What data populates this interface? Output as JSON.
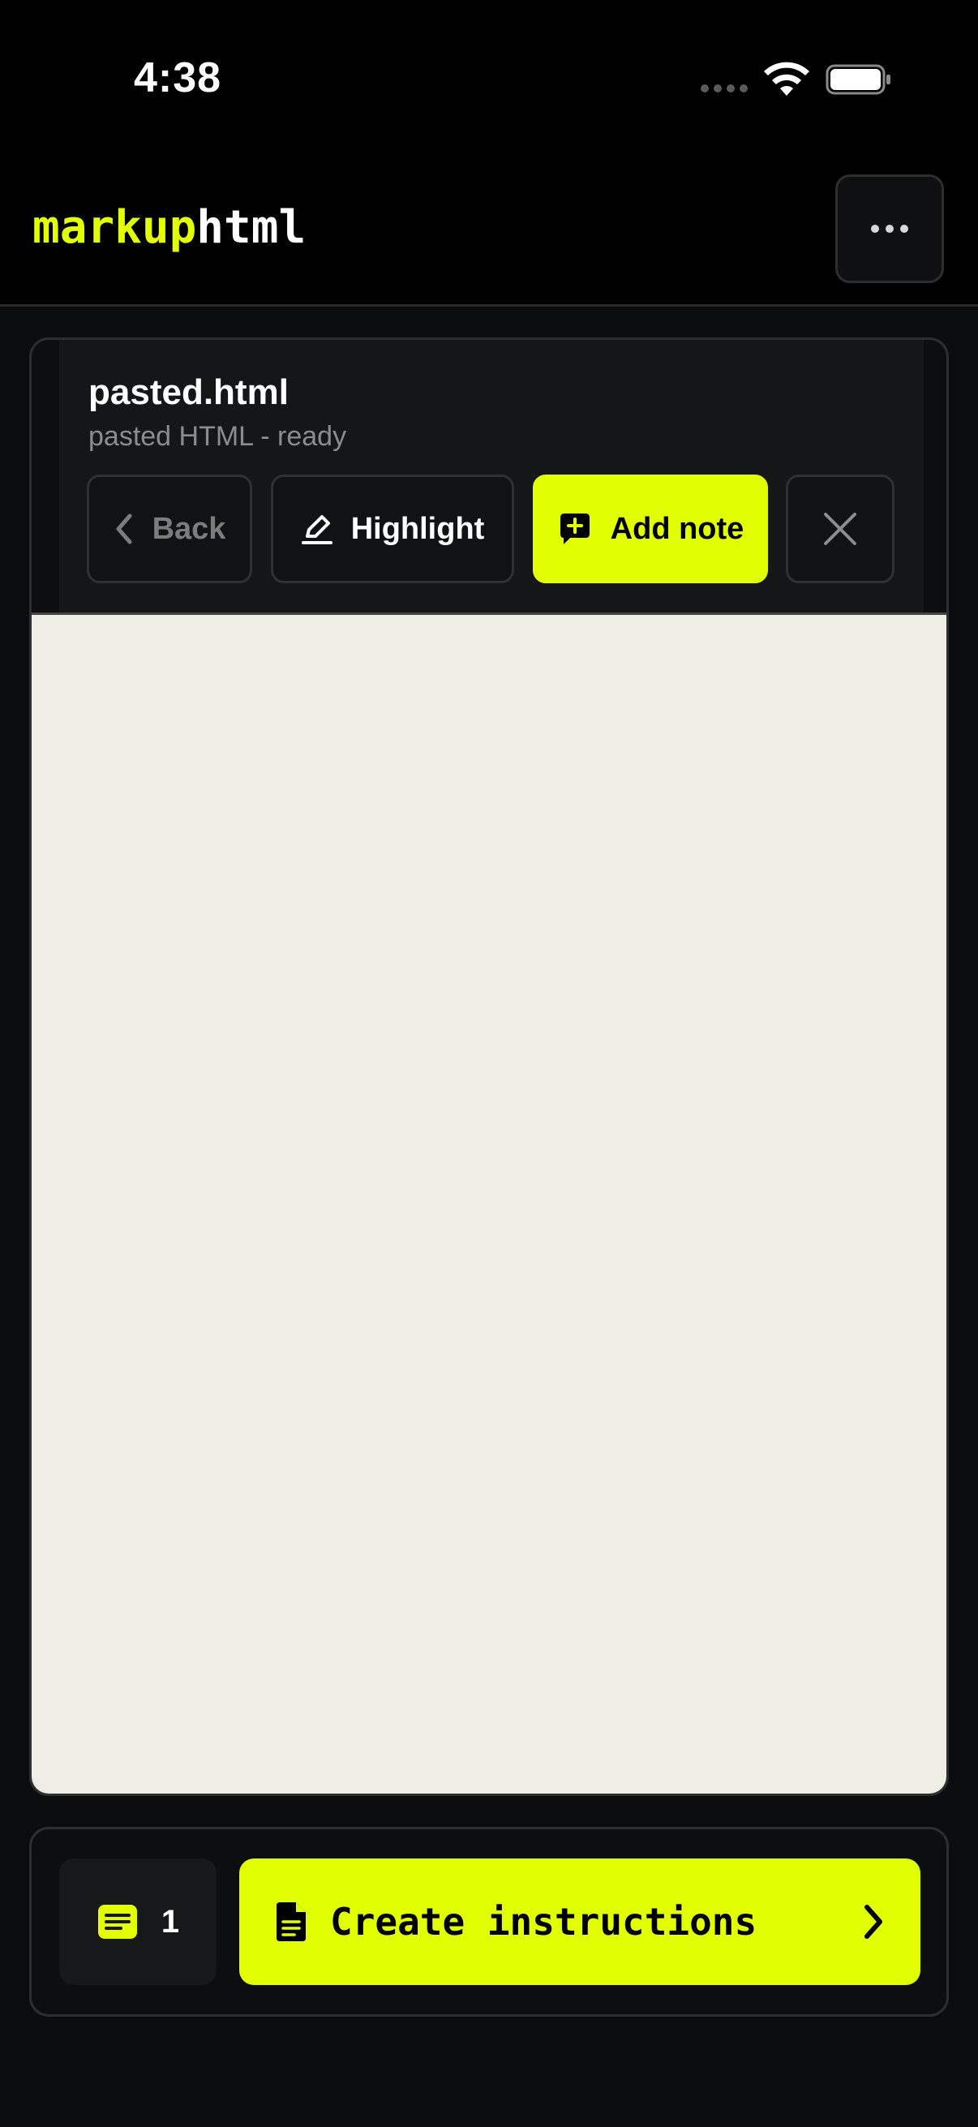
{
  "status_bar": {
    "time": "4:38"
  },
  "header": {
    "logo_part_a": "markup",
    "logo_part_b": "html"
  },
  "document": {
    "title": "pasted.html",
    "subtitle": "pasted HTML - ready"
  },
  "toolbar": {
    "back_label": "Back",
    "highlight_label": "Highlight",
    "add_note_label": "Add note"
  },
  "bottom_bar": {
    "notes_count": "1",
    "create_label": "Create instructions"
  },
  "colors": {
    "accent": "#e1ff00",
    "preview_background": "#eeede6",
    "background": "#0b0c0d"
  }
}
